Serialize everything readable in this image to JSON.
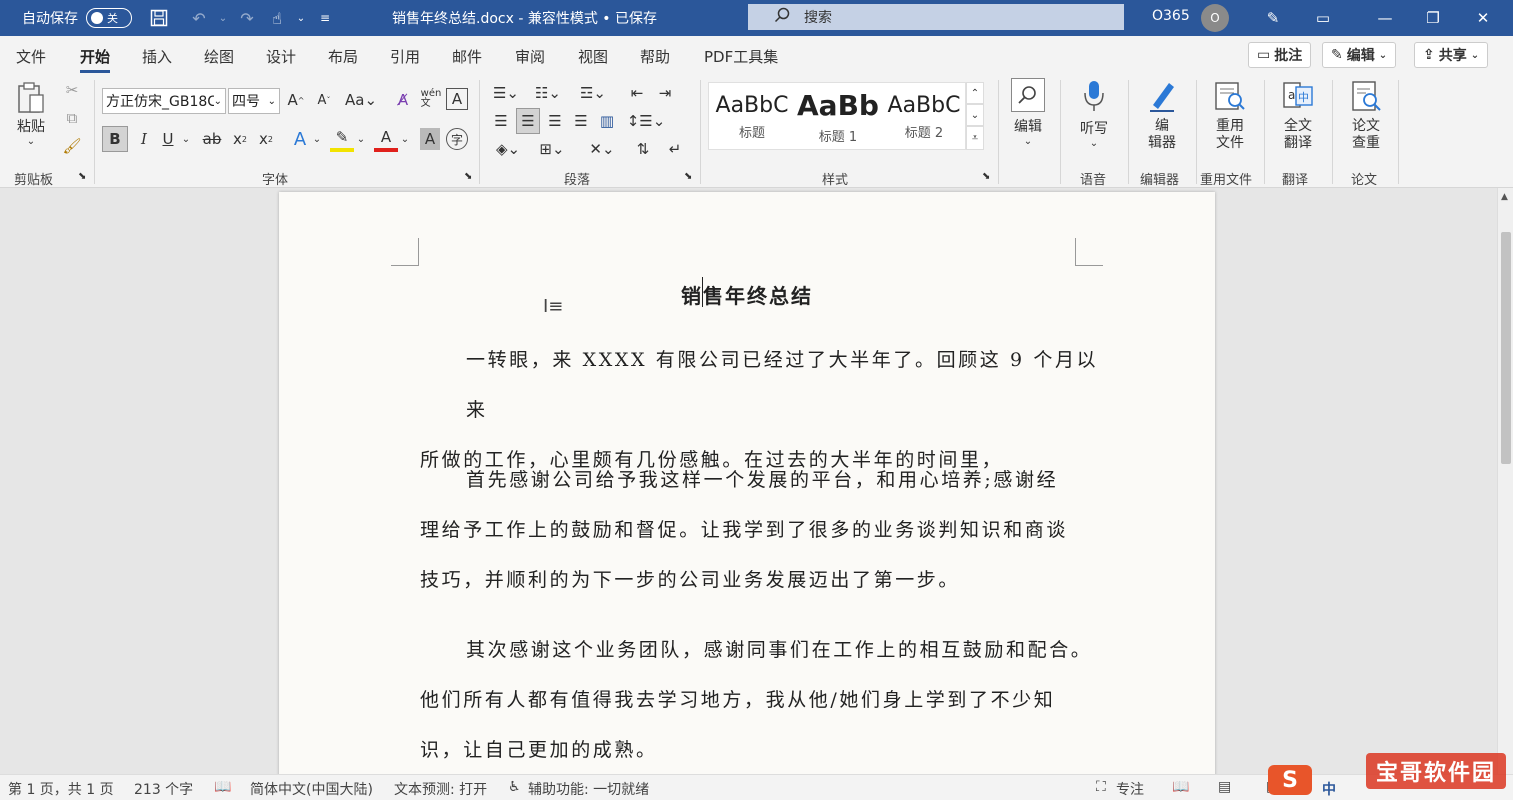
{
  "titlebar": {
    "autosave_label": "自动保存",
    "autosave_state": "关",
    "doc_title": "销售年终总结.docx  -  兼容性模式 • 已保存",
    "search_placeholder": "搜索",
    "account_label": "O365",
    "avatar_initial": "O"
  },
  "menu": {
    "tabs": [
      "文件",
      "开始",
      "插入",
      "绘图",
      "设计",
      "布局",
      "引用",
      "邮件",
      "审阅",
      "视图",
      "帮助",
      "PDF工具集"
    ],
    "active_tab": "开始",
    "comment_btn": "批注",
    "edit_btn": "编辑",
    "share_btn": "共享"
  },
  "ribbon": {
    "paste_label": "粘贴",
    "font_name": "方正仿宋_GB18C",
    "font_size": "四号",
    "styles": [
      {
        "sample": "AaBbC",
        "name": "标题"
      },
      {
        "sample": "AaBb",
        "name": "标题 1"
      },
      {
        "sample": "AaBbC",
        "name": "标题 2"
      }
    ],
    "buttons": {
      "edit": "编辑",
      "dictate": "听写",
      "editor_line1": "编",
      "editor_line2": "辑器",
      "reuse_line1": "重用",
      "reuse_line2": "文件",
      "translate_line1": "全文",
      "translate_line2": "翻译",
      "paper_line1": "论文",
      "paper_line2": "查重"
    },
    "groups": {
      "clipboard": "剪贴板",
      "font": "字体",
      "paragraph": "段落",
      "styles": "样式",
      "voice": "语音",
      "editor": "编辑器",
      "reuse": "重用文件",
      "translate": "翻译",
      "paper": "论文"
    }
  },
  "document": {
    "title": "销售年终总结",
    "paragraphs": [
      [
        "一转眼，来 XXXX 有限公司已经过了大半年了。回顾这 9 个月以来",
        "所做的工作，心里颇有几份感触。在过去的大半年的时间里，"
      ],
      [
        "首先感谢公司给予我这样一个发展的平台，和用心培养;感谢经",
        "理给予工作上的鼓励和督促。让我学到了很多的业务谈判知识和商谈",
        "技巧，并顺利的为下一步的公司业务发展迈出了第一步。"
      ],
      [
        "其次感谢这个业务团队，感谢同事们在工作上的相互鼓励和配合。",
        "他们所有人都有值得我去学习地方，我从他/她们身上学到了不少知",
        "识，让自己更加的成熟。"
      ]
    ]
  },
  "status": {
    "page": "第 1 页，共 1 页",
    "words": "213 个字",
    "language": "简体中文(中国大陆)",
    "prediction": "文本预测: 打开",
    "accessibility": "辅助功能: 一切就绪",
    "focus": "专注",
    "ime": "中",
    "watermark": "宝哥软件园"
  },
  "colors": {
    "titlebar": "#2b579a",
    "ribbon": "#f3f3f3",
    "page": "#fbfaf7"
  }
}
